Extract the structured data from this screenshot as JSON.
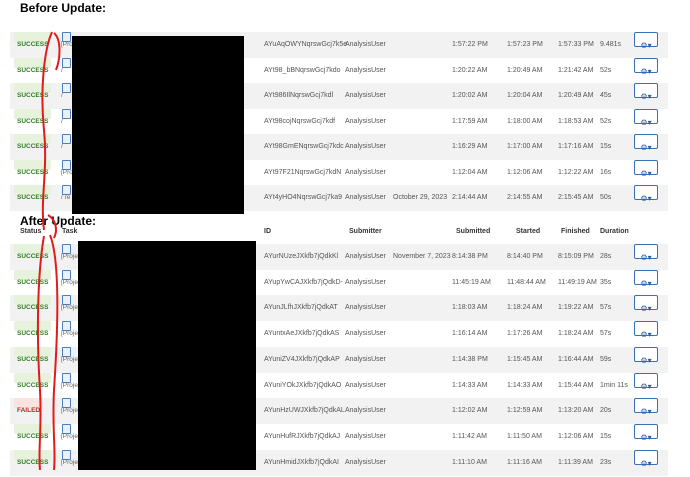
{
  "captions": {
    "before": "Before Update:",
    "after": "After Update:"
  },
  "columns": {
    "status": "Status",
    "task": "Task",
    "id": "ID",
    "submitter": "Submitter",
    "submitted": "Submitted",
    "started": "Started",
    "finished": "Finished",
    "duration": "Duration"
  },
  "gear_label": "⚙▾",
  "before_rows": [
    {
      "status": "SUCCESS",
      "kind": "success",
      "task": "[Proje",
      "id": "AYuAqOWYNqrswGcj7k5e",
      "submitter": "AnalysisUser",
      "date": "",
      "submitted": "1:57:22 PM",
      "started": "1:57:23 PM",
      "finished": "1:57:33 PM",
      "duration": "9.481s"
    },
    {
      "status": "SUCCESS",
      "kind": "success",
      "task": "/",
      "id": "AYt98_bBNqrswGcj7kdo",
      "submitter": "AnalysisUser",
      "date": "",
      "submitted": "1:20:22 AM",
      "started": "1:20:49 AM",
      "finished": "1:21:42 AM",
      "duration": "52s"
    },
    {
      "status": "SUCCESS",
      "kind": "success",
      "task": "/",
      "id": "AYt986IlNqrswGcj7kdl",
      "submitter": "AnalysisUser",
      "date": "",
      "submitted": "1:20:02 AM",
      "started": "1:20:04 AM",
      "finished": "1:20:49 AM",
      "duration": "45s"
    },
    {
      "status": "SUCCESS",
      "kind": "success",
      "task": "/",
      "id": "AYt98cojNqrswGcj7kdf",
      "submitter": "AnalysisUser",
      "date": "",
      "submitted": "1:17:59 AM",
      "started": "1:18:00 AM",
      "finished": "1:18:53 AM",
      "duration": "52s"
    },
    {
      "status": "SUCCESS",
      "kind": "success",
      "task": "/",
      "id": "AYt98GmENqrswGcj7kdc",
      "submitter": "AnalysisUser",
      "date": "",
      "submitted": "1:16:29 AM",
      "started": "1:17:00 AM",
      "finished": "1:17:16 AM",
      "duration": "15s"
    },
    {
      "status": "SUCCESS",
      "kind": "success",
      "task": "[Proje",
      "id": "AYt97F21NqrswGcj7kdN",
      "submitter": "AnalysisUser",
      "date": "",
      "submitted": "1:12:04 AM",
      "started": "1:12:06 AM",
      "finished": "1:12:22 AM",
      "duration": "16s"
    },
    {
      "status": "SUCCESS",
      "kind": "success",
      "task": "/ re",
      "id": "AYt4yHO4NqrswGcj7ka9",
      "submitter": "AnalysisUser",
      "date": "October 29, 2023",
      "submitted": "2:14:44 AM",
      "started": "2:14:55 AM",
      "finished": "2:15:45 AM",
      "duration": "50s"
    }
  ],
  "after_rows": [
    {
      "status": "SUCCESS",
      "kind": "success",
      "task": "[Proje",
      "id": "AYurNUzeJXkfb7jQdkKl",
      "submitter": "AnalysisUser",
      "date": "November 7, 2023",
      "submitted": "8:14:38 PM",
      "started": "8:14:40 PM",
      "finished": "8:15:09 PM",
      "duration": "28s"
    },
    {
      "status": "SUCCESS",
      "kind": "success",
      "task": "[Proje",
      "id": "AYupYwCAJXkfb7jQdkD-",
      "submitter": "AnalysisUser",
      "date": "",
      "submitted": "11:45:19 AM",
      "started": "11:48:44 AM",
      "finished": "11:49:19 AM",
      "duration": "35s"
    },
    {
      "status": "SUCCESS",
      "kind": "success",
      "task": "[Proje",
      "id": "AYunJLfhJXkfb7jQdkAT",
      "submitter": "AnalysisUser",
      "date": "",
      "submitted": "1:18:03 AM",
      "started": "1:18:24 AM",
      "finished": "1:19:22 AM",
      "duration": "57s"
    },
    {
      "status": "SUCCESS",
      "kind": "success",
      "task": "[Proje",
      "id": "AYuntxAeJXkfb7jQdkAS",
      "submitter": "AnalysisUser",
      "date": "",
      "submitted": "1:16:14 AM",
      "started": "1:17:26 AM",
      "finished": "1:18:24 AM",
      "duration": "57s"
    },
    {
      "status": "SUCCESS",
      "kind": "success",
      "task": "[Proje",
      "id": "AYuniZV4JXkfb7jQdkAP",
      "submitter": "AnalysisUser",
      "date": "",
      "submitted": "1:14:38 PM",
      "started": "1:15:45 AM",
      "finished": "1:16:44 AM",
      "duration": "59s"
    },
    {
      "status": "SUCCESS",
      "kind": "success",
      "task": "[Proje",
      "id": "AYuniYOkJXkfb7jQdkAO",
      "submitter": "AnalysisUser",
      "date": "",
      "submitted": "1:14:33 AM",
      "started": "1:14:33 AM",
      "finished": "1:15:44 AM",
      "duration": "1min 11s"
    },
    {
      "status": "FAILED",
      "kind": "failed",
      "task": "[Proje",
      "id": "AYunHzUWJXkfb7jQdkAL",
      "submitter": "AnalysisUser",
      "date": "",
      "submitted": "1:12:02 AM",
      "started": "1:12:59 AM",
      "finished": "1:13:20 AM",
      "duration": "20s"
    },
    {
      "status": "SUCCESS",
      "kind": "success",
      "task": "[Proje",
      "id": "AYunHufRJXkfb7jQdkAJ",
      "submitter": "AnalysisUser",
      "date": "",
      "submitted": "1:11:42 AM",
      "started": "1:11:50 AM",
      "finished": "1:12:06 AM",
      "duration": "15s"
    },
    {
      "status": "SUCCESS",
      "kind": "success",
      "task": "[Proje",
      "id": "AYunHmidJXkfb7jQdkAI",
      "submitter": "AnalysisUser",
      "date": "",
      "submitted": "1:11:10 AM",
      "started": "1:11:16 AM",
      "finished": "1:11:39 AM",
      "duration": "23s"
    }
  ]
}
